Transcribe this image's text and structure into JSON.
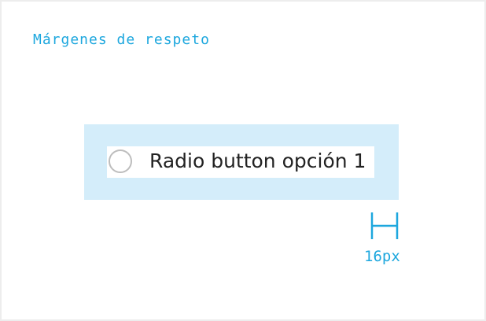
{
  "diagram": {
    "title": "Márgenes de respeto",
    "radio_label": "Radio button opción 1",
    "radio_checked": false,
    "measurement_label": "16px"
  },
  "colors": {
    "accent": "#1da7de",
    "margin_zone": "#d4edfa",
    "radio_border": "#bdbdbd",
    "text": "#222222",
    "frame_border": "#ededed"
  },
  "icons": {
    "measure": "horizontal-dimension-bracket",
    "radio": "radio-unchecked"
  }
}
